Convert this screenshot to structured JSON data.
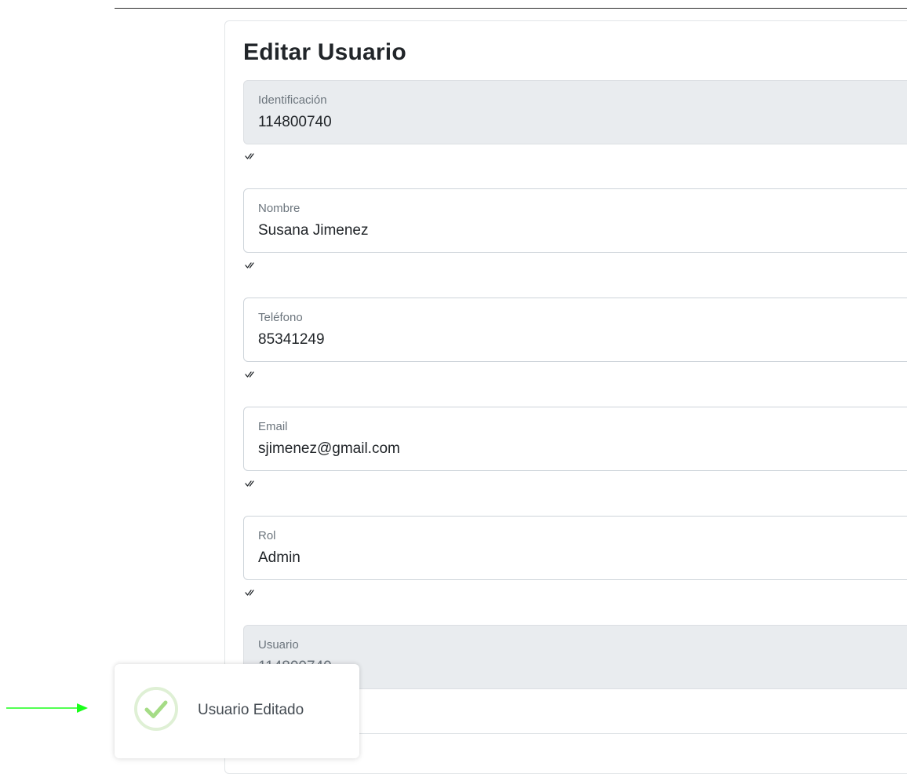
{
  "form": {
    "title": "Editar Usuario",
    "fields": [
      {
        "label": "Identificación",
        "value": "114800740",
        "disabled": true
      },
      {
        "label": "Nombre",
        "value": "Susana Jimenez",
        "disabled": false
      },
      {
        "label": "Teléfono",
        "value": "85341249",
        "disabled": false
      },
      {
        "label": "Email",
        "value": "sjimenez@gmail.com",
        "disabled": false
      },
      {
        "label": "Rol",
        "value": "Admin",
        "disabled": false
      },
      {
        "label": "Usuario",
        "value": "114800740",
        "disabled": true
      }
    ],
    "validation_icon": "double-check-icon"
  },
  "toast": {
    "message": "Usuario Editado",
    "icon": "success-check-icon",
    "icon_color": "#a5dc86"
  },
  "annotation": {
    "arrow_color": "#1aff1a"
  },
  "colors": {
    "disabled_bg": "#e9ecef",
    "border": "#ced4da",
    "label": "#6c757d"
  }
}
